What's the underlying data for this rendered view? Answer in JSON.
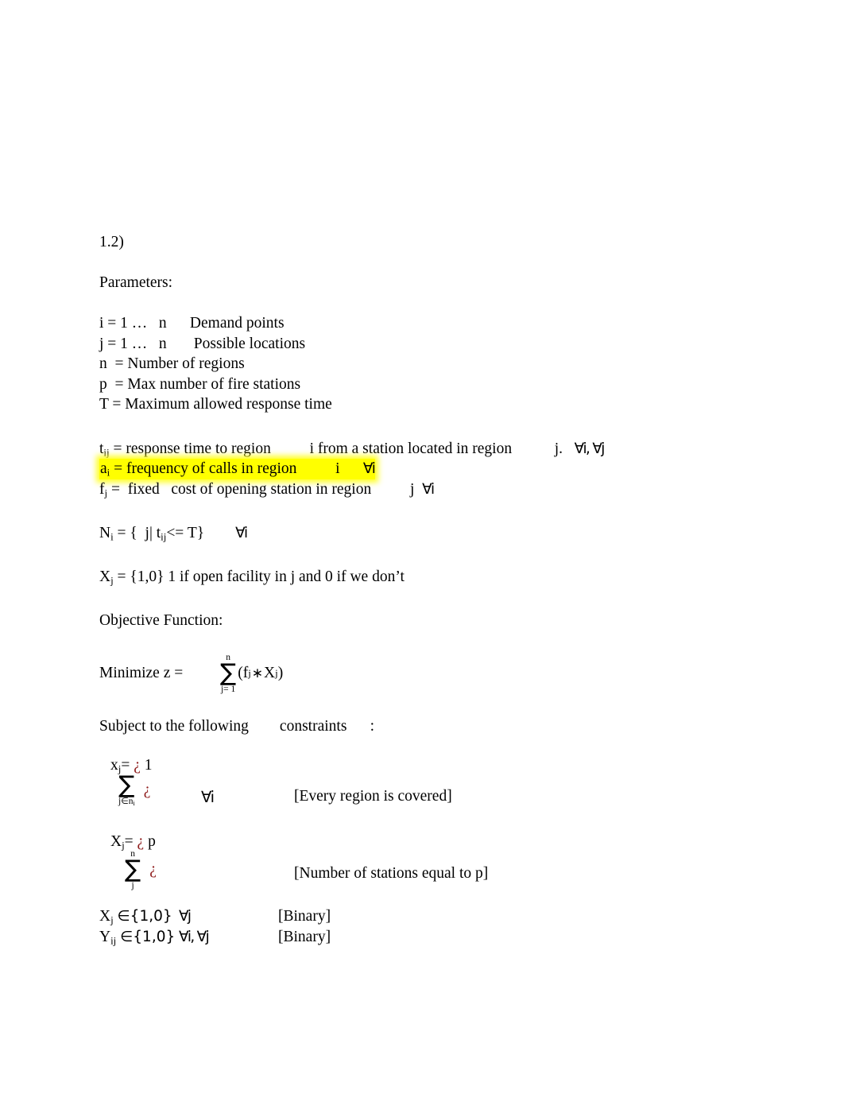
{
  "document": {
    "section_number": "1.2)",
    "parameters_heading": "Parameters:",
    "parameter_lines": [
      {
        "lhs": "i = 1 …",
        "var": "n",
        "desc": "Demand points"
      },
      {
        "lhs": "j = 1 …",
        "var": "n",
        "desc": "Possible locations"
      }
    ],
    "simple_definitions": [
      "n  = Number of regions",
      "p  = Max number of fire stations",
      "T = Maximum allowed response time"
    ],
    "indexed_definitions": {
      "t": {
        "symbol": "t",
        "subscript": "ij",
        "text_before": " = response time to region",
        "mid_index": "i",
        "text_after": "from a station located in region",
        "tail_index": "j.",
        "quantifiers": "∀i, ∀j",
        "highlighted": false
      },
      "a": {
        "symbol": "a",
        "subscript": "i",
        "text_before": " = frequency of calls in region",
        "mid_index": "i",
        "quantifiers": "∀i",
        "highlighted": true,
        "highlight_color": "#ffff00"
      },
      "f": {
        "symbol": "f",
        "subscript": "j",
        "text_before": " =  fixed   cost of opening station in region",
        "tail_index": "j",
        "quantifiers": "∀i",
        "highlighted": false
      }
    },
    "set_definition": {
      "symbol": "N",
      "subscript": "i",
      "body_pre": " = {  j| t",
      "body_sub": "ij",
      "body_post": "<= T}",
      "quantifier": "∀i"
    },
    "decision_variable": {
      "symbol": "X",
      "subscript": "j",
      "text": " = {1,0} 1 if open facility in j and 0 if we don’t"
    },
    "objective": {
      "heading": "Objective Function:",
      "label": "Minimize z =",
      "sum_upper": "n",
      "sum_lower": "j= 1",
      "expression_open": "(f",
      "expression_sub1": "j",
      "operator": "∗",
      "expression_var2": "X",
      "expression_sub2": "j",
      "expression_close": ")"
    },
    "constraints_heading": "Subject to the following        constraints      :",
    "constraints": [
      {
        "top_var": "x",
        "top_sub": "j",
        "top_eq": "=",
        "artifact": "¿",
        "top_rhs": "1",
        "sum_lower_pre": "j",
        "sum_lower_symbol": "∈",
        "sum_lower_set": "n",
        "sum_lower_set_sub": "i",
        "sum_upper": "",
        "sum_artifact": "¿",
        "quantifier": "∀i",
        "note": "[Every region is covered]"
      },
      {
        "top_var": "X",
        "top_sub": "j",
        "top_eq": "=",
        "artifact": "¿",
        "top_rhs": "p",
        "sum_lower_pre": "j",
        "sum_lower_symbol": "",
        "sum_lower_set": "",
        "sum_lower_set_sub": "",
        "sum_upper": "n",
        "sum_artifact": "¿",
        "quantifier": "",
        "note": "[Number of stations equal to p]"
      }
    ],
    "binary_constraints": [
      {
        "var": "X",
        "sub": "j",
        "membership": "∈{1,0}",
        "quantifier": "∀j",
        "note": "[Binary]"
      },
      {
        "var": "Y",
        "sub": "ij",
        "membership": "∈{1,0}",
        "quantifier": "∀i, ∀j",
        "note": "[Binary]"
      }
    ],
    "artifact_color": "#8f1d1d"
  }
}
